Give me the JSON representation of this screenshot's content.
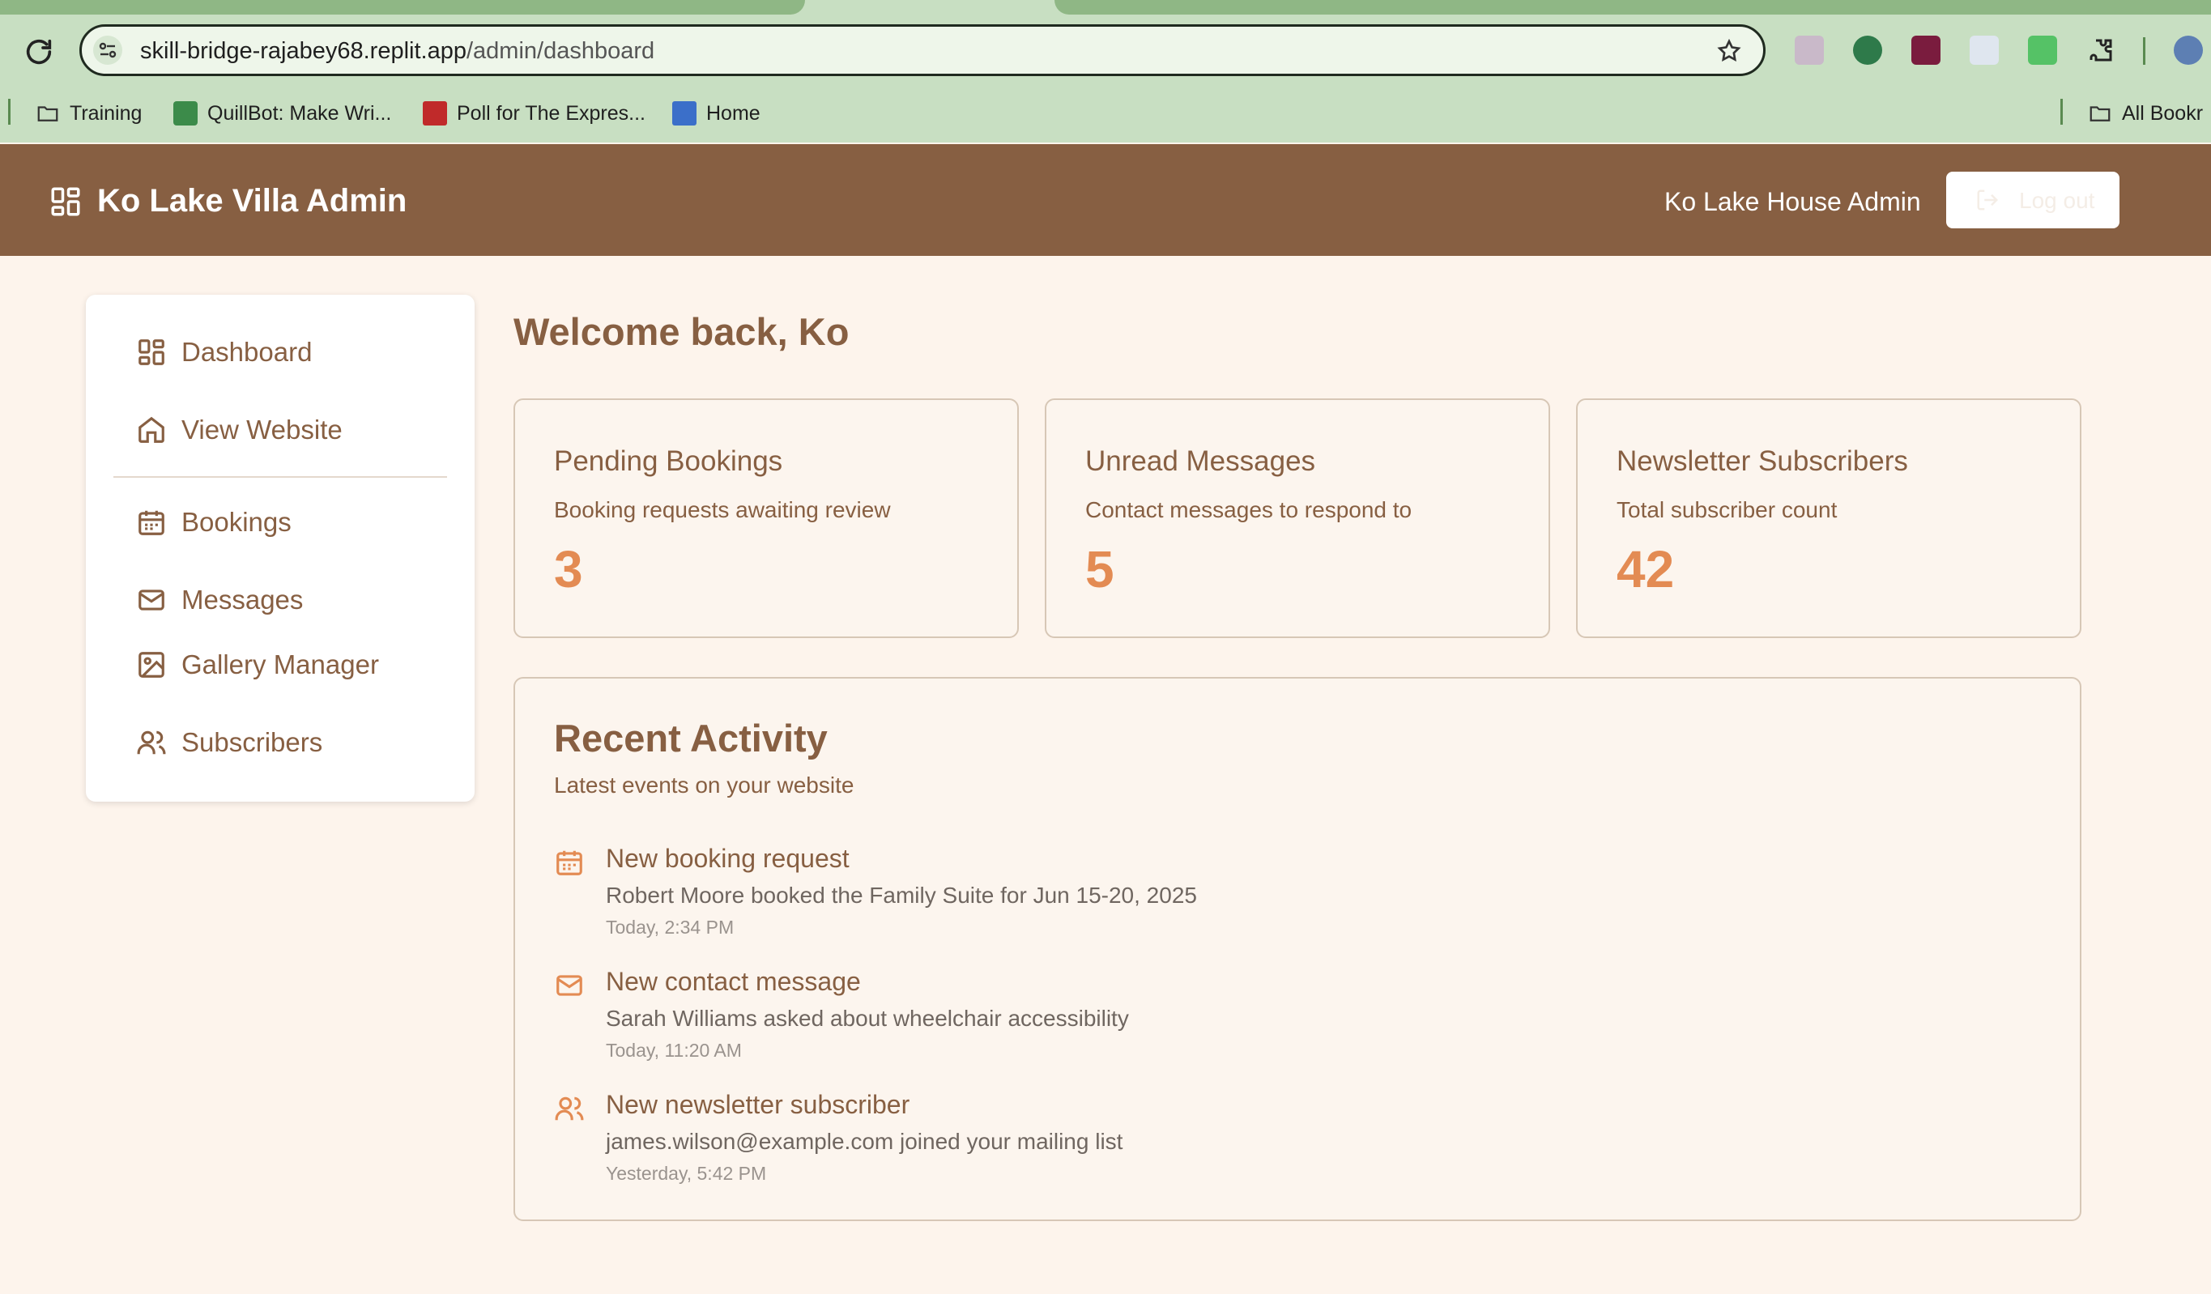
{
  "browser": {
    "url_host": "skill-bridge-rajabey68.replit.app",
    "url_path": "/admin/dashboard",
    "bookmarks": [
      {
        "label": "Training",
        "icon": "folder-icon"
      },
      {
        "label": "QuillBot: Make Wri...",
        "icon": "quillbot-icon"
      },
      {
        "label": "Poll for The Expres...",
        "icon": "poll-icon"
      },
      {
        "label": "Home",
        "icon": "th-icon"
      }
    ],
    "all_bookmarks_label": "All Bookr"
  },
  "header": {
    "title": "Ko Lake Villa Admin",
    "admin_name": "Ko Lake House Admin",
    "logout_label": "Log out"
  },
  "sidebar": {
    "items": [
      {
        "label": "Dashboard",
        "icon": "dashboard-icon"
      },
      {
        "label": "View Website",
        "icon": "home-icon"
      },
      {
        "label": "Bookings",
        "icon": "calendar-icon"
      },
      {
        "label": "Messages",
        "icon": "mail-icon"
      },
      {
        "label": "Gallery Manager",
        "icon": "image-icon"
      },
      {
        "label": "Subscribers",
        "icon": "users-icon"
      }
    ]
  },
  "main": {
    "welcome": "Welcome back, Ko",
    "stats": [
      {
        "title": "Pending Bookings",
        "desc": "Booking requests awaiting review",
        "value": "3"
      },
      {
        "title": "Unread Messages",
        "desc": "Contact messages to respond to",
        "value": "5"
      },
      {
        "title": "Newsletter Subscribers",
        "desc": "Total subscriber count",
        "value": "42"
      }
    ],
    "activity": {
      "title": "Recent Activity",
      "subtitle": "Latest events on your website",
      "items": [
        {
          "title": "New booking request",
          "desc": "Robert Moore booked the Family Suite for Jun 15-20, 2025",
          "time": "Today, 2:34 PM",
          "icon": "calendar-icon"
        },
        {
          "title": "New contact message",
          "desc": "Sarah Williams asked about wheelchair accessibility",
          "time": "Today, 11:20 AM",
          "icon": "mail-icon"
        },
        {
          "title": "New newsletter subscriber",
          "desc": "james.wilson@example.com joined your mailing list",
          "time": "Yesterday, 5:42 PM",
          "icon": "users-icon"
        }
      ]
    }
  },
  "colors": {
    "header_brown": "#875f42",
    "accent_orange": "#e38b53",
    "page_bg": "#fdf4ec"
  }
}
